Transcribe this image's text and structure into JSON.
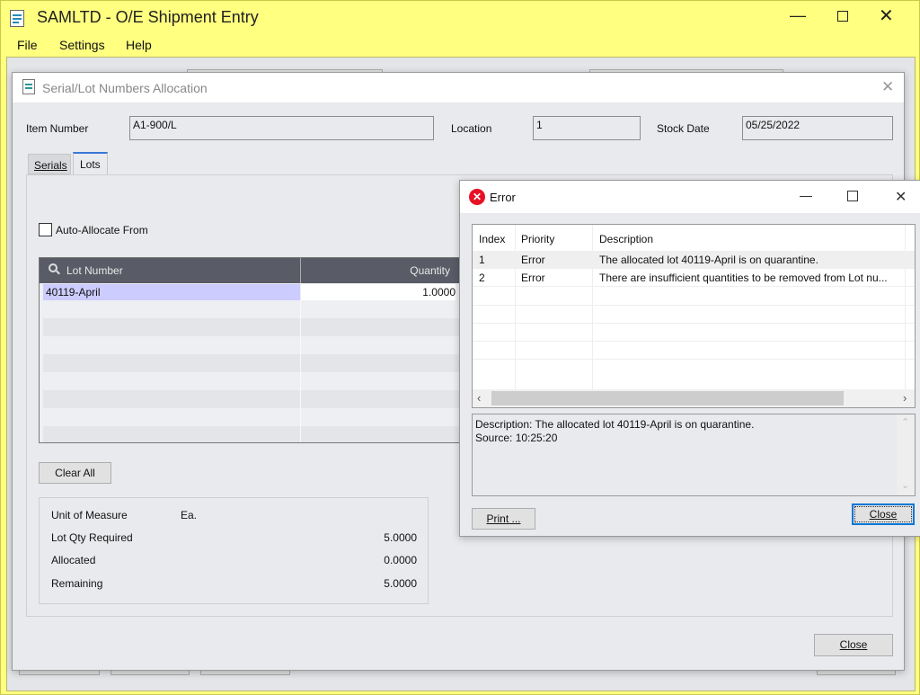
{
  "main_window": {
    "title": "SAMLTD - O/E Shipment Entry",
    "menu": [
      "File",
      "Settings",
      "Help"
    ],
    "frame_color": "#ffff80"
  },
  "allocation_dialog": {
    "title": "Serial/Lot Numbers Allocation",
    "item_number_label": "Item Number",
    "item_number": "A1-900/L",
    "location_label": "Location",
    "location": "1",
    "stock_date_label": "Stock Date",
    "stock_date": "05/25/2022",
    "tabs": [
      {
        "label": "Serials",
        "active": false
      },
      {
        "label": "Lots",
        "active": true
      }
    ],
    "auto_allocate_label": "Auto-Allocate From",
    "auto_allocate_checked": false,
    "grid": {
      "columns": [
        "Lot Number",
        "Quantity"
      ],
      "rows": [
        {
          "lot": "40119-April",
          "quantity": "1.0000"
        }
      ]
    },
    "clear_all_label": "Clear All",
    "summary": [
      {
        "label": "Unit of Measure",
        "value": "Ea."
      },
      {
        "label": "Lot Qty Required",
        "value": "5.0000"
      },
      {
        "label": "Allocated",
        "value": "0.0000"
      },
      {
        "label": "Remaining",
        "value": "5.0000"
      }
    ],
    "close_label": "Close"
  },
  "error_dialog": {
    "title": "Error",
    "icon": "error-x-icon",
    "icon_color": "#e81123",
    "columns": [
      "Index",
      "Priority",
      "Description"
    ],
    "rows": [
      {
        "index": "1",
        "priority": "Error",
        "description": "The allocated lot 40119-April is on quarantine."
      },
      {
        "index": "2",
        "priority": "Error",
        "description": "There are insufficient quantities to be removed from Lot nu..."
      }
    ],
    "detail": {
      "description": "Description: The allocated lot 40119-April is on quarantine.",
      "source": "Source:  10:25:20"
    },
    "print_label": "Print ...",
    "close_label": "Close",
    "focus_color": "#0078d7"
  }
}
